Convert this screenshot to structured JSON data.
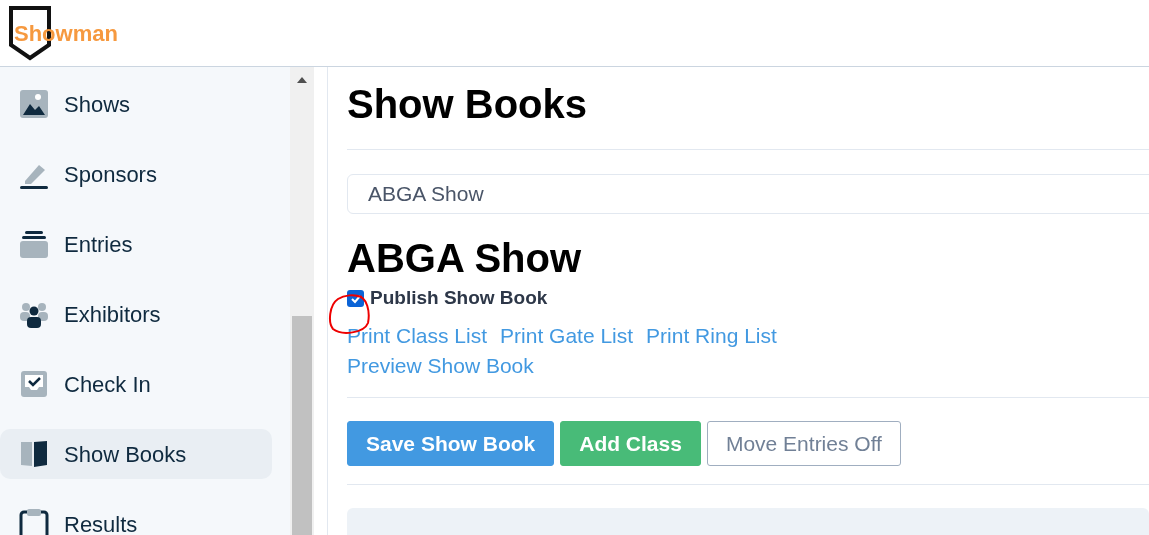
{
  "logo": {
    "text": "Showman"
  },
  "sidebar": {
    "items": [
      {
        "label": "Shows",
        "kind": "image",
        "selected": false
      },
      {
        "label": "Sponsors",
        "kind": "pen",
        "selected": false
      },
      {
        "label": "Entries",
        "kind": "stack",
        "selected": false
      },
      {
        "label": "Exhibitors",
        "kind": "people",
        "selected": false
      },
      {
        "label": "Check In",
        "kind": "check",
        "selected": false
      },
      {
        "label": "Show Books",
        "kind": "book",
        "selected": true
      },
      {
        "label": "Results",
        "kind": "clipboard",
        "selected": false
      }
    ]
  },
  "main": {
    "title": "Show Books",
    "show_select": {
      "value": "ABGA Show"
    },
    "show_title": "ABGA Show",
    "publish": {
      "label": "Publish Show Book",
      "checked": true
    },
    "links": [
      "Print Class List",
      "Print Gate List",
      "Print Ring List",
      "Preview Show Book"
    ],
    "buttons": [
      {
        "label": "Save Show Book",
        "kind": "primary"
      },
      {
        "label": "Add Class",
        "kind": "success"
      },
      {
        "label": "Move Entries Off",
        "kind": "outline"
      }
    ]
  }
}
